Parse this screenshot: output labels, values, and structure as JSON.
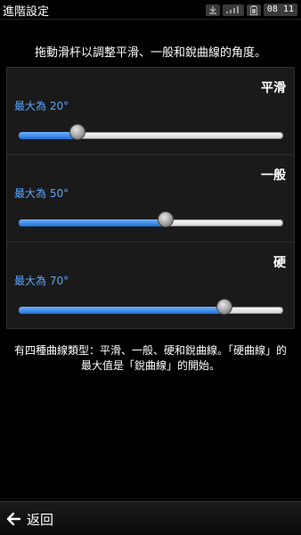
{
  "header": {
    "title": "進階設定",
    "clock": "08 11"
  },
  "instruction": "拖動滑杆以調整平滑、一般和銳曲線的角度。",
  "sliders": [
    {
      "name": "平滑",
      "value_label": "最大為 20°",
      "value": 20,
      "min": 0,
      "max": 90,
      "accent": "#5aa6ff"
    },
    {
      "name": "一般",
      "value_label": "最大為 50°",
      "value": 50,
      "min": 0,
      "max": 90,
      "accent": "#5aa6ff"
    },
    {
      "name": "硬",
      "value_label": "最大為 70°",
      "value": 70,
      "min": 0,
      "max": 90,
      "accent": "#5aa6ff"
    }
  ],
  "note": "有四種曲線類型：平滑、一般、硬和銳曲線。「硬曲線」的最大值是「銳曲線」的開始。",
  "footer": {
    "back_label": "返回"
  }
}
